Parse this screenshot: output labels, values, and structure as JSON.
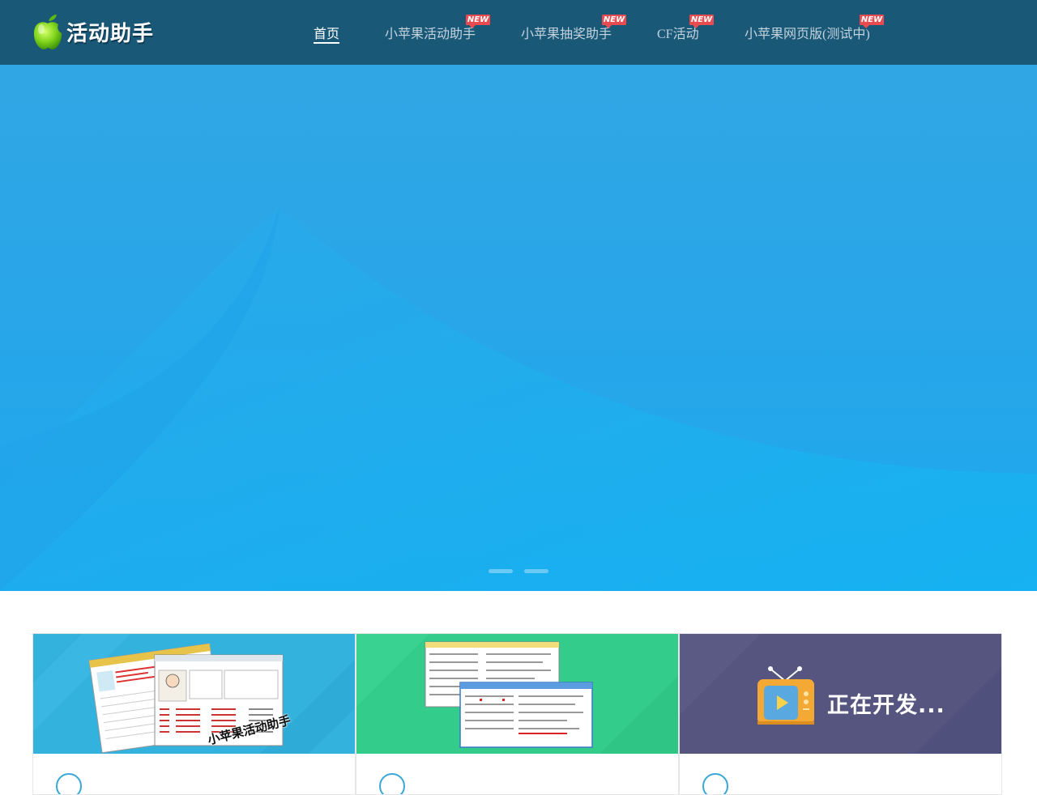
{
  "header": {
    "logo_text": "活动助手",
    "logo_icon": "apple-icon",
    "nav": [
      {
        "label": "首页",
        "active": true,
        "badge": ""
      },
      {
        "label": "小苹果活动助手",
        "active": false,
        "badge": "NEW"
      },
      {
        "label": "小苹果抽奖助手",
        "active": false,
        "badge": "NEW"
      },
      {
        "label": "CF活动",
        "active": false,
        "badge": "NEW"
      },
      {
        "label": "小苹果网页版(测试中)",
        "active": false,
        "badge": "NEW"
      }
    ]
  },
  "hero": {
    "slide_count": 2,
    "colors": {
      "top": "#31a6e4",
      "bottom": "#1fa9ee",
      "curve": "#13b7f2"
    }
  },
  "cards": [
    {
      "bg": "#33b2de",
      "stamp": "小苹果活动助手",
      "icon": "app-screenshot"
    },
    {
      "bg": "#34cc8b",
      "icon": "app-screenshot"
    },
    {
      "bg": "#555580",
      "title": "正在开发...",
      "icon": "tv-play-icon"
    }
  ],
  "colors": {
    "header_bg": "#1a5878",
    "badge": "#e84c50"
  }
}
